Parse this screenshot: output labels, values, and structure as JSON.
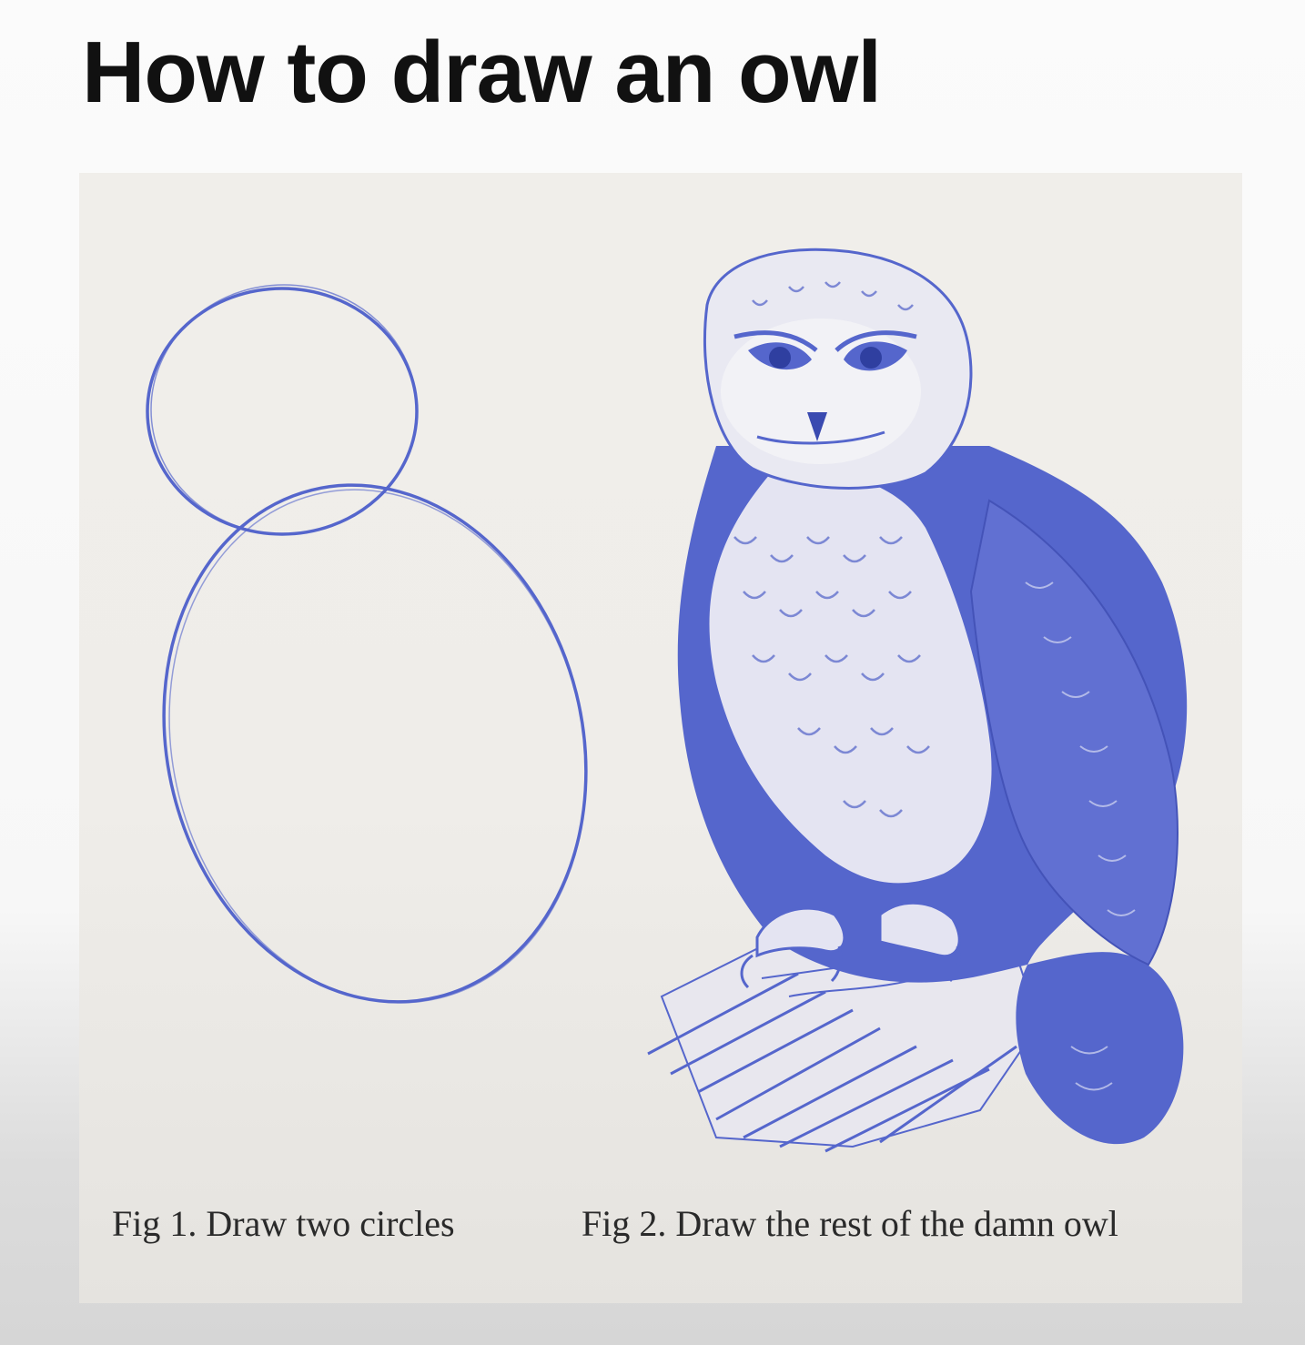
{
  "title": "How to draw an owl",
  "figures": [
    {
      "caption": "Fig 1. Draw two circles"
    },
    {
      "caption": "Fig 2. Draw the rest of the damn owl"
    }
  ],
  "colors": {
    "ink": "#5566cc",
    "paper": "#efede9",
    "text": "#111111"
  }
}
